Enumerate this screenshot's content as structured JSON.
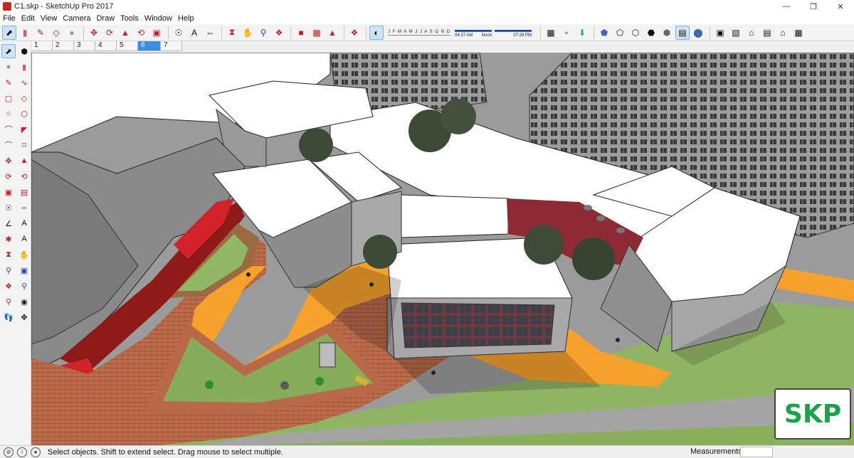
{
  "window": {
    "title": "C1.skp - SketchUp Pro 2017"
  },
  "menu": [
    "File",
    "Edit",
    "View",
    "Camera",
    "Draw",
    "Tools",
    "Window",
    "Help"
  ],
  "shadow": {
    "months": "J F M A M J J A S O N D",
    "time_start": "04:37 AM",
    "time_mid": "Noon",
    "time_end": "07:28 PM"
  },
  "scenes": [
    "1",
    "2",
    "3",
    "4",
    "5",
    "6",
    "7"
  ],
  "active_scene": "6",
  "status": {
    "hint": "Select objects. Shift to extend select. Drag mouse to select multiple.",
    "measurements_label": "Measurements",
    "measurements_value": ""
  },
  "watermark": "SKP",
  "colors": {
    "accent": "#3a90e0",
    "roof": "#ffffff",
    "paving_orange": "#f5a12c",
    "brick": "#b86a48",
    "lawn": "#8db260",
    "road": "#9a9a9a",
    "red_wall": "#8e2a33",
    "watermark_green": "#1aa34a"
  },
  "toolbar_icons": [
    "select-icon",
    "eraser-icon",
    "pencil-icon",
    "shape-icon",
    "paint-bucket-icon",
    "move-icon",
    "rotate-icon",
    "push-pull-icon",
    "offset-icon",
    "tape-icon",
    "text-icon",
    "dimension-icon",
    "orbit-icon",
    "pan-icon",
    "zoom-icon",
    "zoom-extents-icon",
    "warehouse-icon",
    "extension-icon",
    "layer-icon",
    "shadow-toggle-icon",
    "fog-icon",
    "section-icon",
    "views-icon",
    "styles-icon"
  ],
  "palette_icons": [
    "select-icon",
    "component-icon",
    "paint-icon",
    "eraser-icon",
    "line-icon",
    "freehand-icon",
    "rectangle-icon",
    "rotated-rect-icon",
    "circle-icon",
    "polygon-icon",
    "arc-icon",
    "pie-icon",
    "arc2-icon",
    "arc3-icon",
    "move-icon",
    "push-pull-icon",
    "rotate-icon",
    "follow-me-icon",
    "scale-icon",
    "offset-icon",
    "tape-icon",
    "dimension-icon",
    "protractor-icon",
    "text-icon",
    "axes-icon",
    "3d-text-icon",
    "orbit-icon",
    "pan-icon",
    "zoom-icon",
    "zoom-window-icon",
    "zoom-extents-icon",
    "prev-view-icon",
    "position-camera-icon",
    "walk-icon",
    "look-around-icon",
    "section-plane-icon"
  ]
}
